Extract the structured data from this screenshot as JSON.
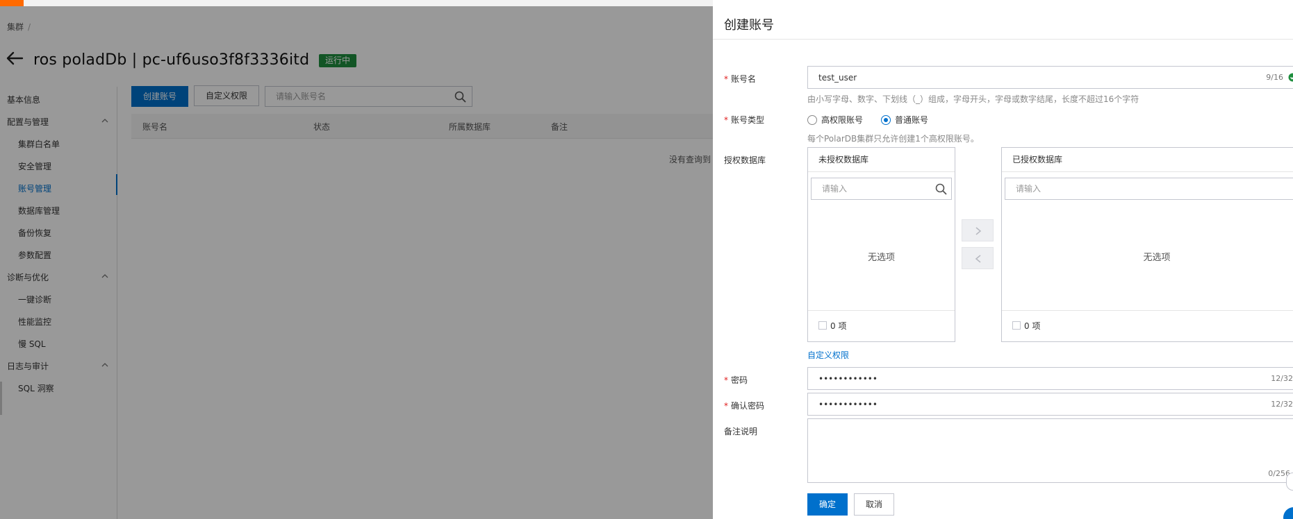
{
  "breadcrumb": {
    "item": "集群",
    "separator": "/"
  },
  "page": {
    "title": "ros poladDb | pc-uf6uso3f8f3336itd",
    "status": "运行中"
  },
  "sidebar": {
    "items": [
      {
        "label": "基本信息"
      },
      {
        "label": "配置与管理"
      },
      {
        "label": "集群白名单"
      },
      {
        "label": "安全管理"
      },
      {
        "label": "账号管理"
      },
      {
        "label": "数据库管理"
      },
      {
        "label": "备份恢复"
      },
      {
        "label": "参数配置"
      },
      {
        "label": "诊断与优化"
      },
      {
        "label": "一键诊断"
      },
      {
        "label": "性能监控"
      },
      {
        "label": "慢 SQL"
      },
      {
        "label": "日志与审计"
      },
      {
        "label": "SQL 洞察"
      }
    ],
    "active": "账号管理"
  },
  "toolbar": {
    "create_label": "创建账号",
    "custom_perm_label": "自定义权限",
    "search_placeholder": "请输入账号名"
  },
  "table": {
    "columns": [
      "账号名",
      "状态",
      "所属数据库",
      "备注"
    ],
    "empty_text": "没有查询到"
  },
  "drawer": {
    "title": "创建账号",
    "account_name": {
      "label": "账号名",
      "value": "test_user",
      "counter": "9/16",
      "help": "由小写字母、数字、下划线（_）组成，字母开头，字母或数字结尾，长度不超过16个字符"
    },
    "account_type": {
      "label": "账号类型",
      "options": [
        "高权限账号",
        "普通账号"
      ],
      "selected": "普通账号",
      "help": "每个PolarDB集群只允许创建1个高权限账号。"
    },
    "databases": {
      "label": "授权数据库",
      "left": {
        "title": "未授权数据库",
        "placeholder": "请输入",
        "empty": "无选项",
        "count": "0 项"
      },
      "right": {
        "title": "已授权数据库",
        "placeholder": "请输入",
        "empty": "无选项",
        "count": "0 项"
      }
    },
    "custom_perm_link": "自定义权限",
    "password": {
      "label": "密码",
      "value": "••••••••••••",
      "counter": "12/32"
    },
    "confirm_password": {
      "label": "确认密码",
      "value": "••••••••••••",
      "counter": "12/32"
    },
    "remark": {
      "label": "备注说明",
      "counter": "0/256"
    },
    "ok_label": "确定",
    "cancel_label": "取消"
  },
  "colors": {
    "accent": "#0070cc",
    "status_green": "#1e8e3e",
    "brand_orange": "#ff6a00",
    "required": "#e02020"
  }
}
